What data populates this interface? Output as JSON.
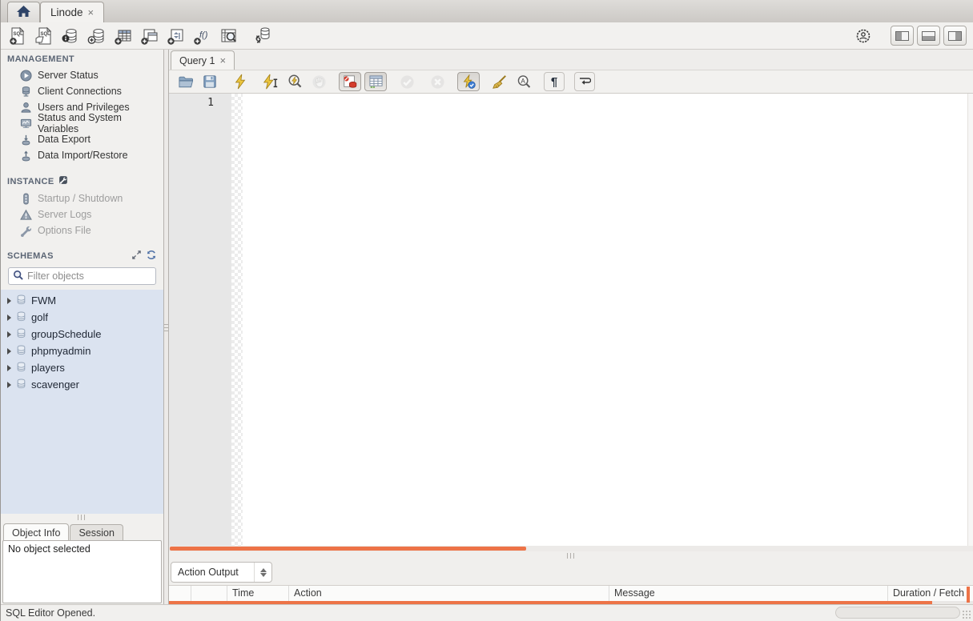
{
  "window": {
    "connection_tabs": [
      {
        "label": "",
        "icon": "home-icon"
      },
      {
        "label": "Linode",
        "close": "×",
        "active": true
      }
    ],
    "status_bar_message": "SQL Editor Opened."
  },
  "main_toolbar": {
    "left_icons": [
      "new-sql-tab-icon",
      "open-sql-script-icon",
      "schema-inspector-icon",
      "create-schema-icon",
      "create-table-icon",
      "create-view-icon",
      "create-procedure-icon",
      "create-function-icon",
      "search-table-data-icon",
      "reconnect-dbms-icon"
    ],
    "right_icons": [
      "account-gear-icon",
      "toggle-left-sidebar-icon",
      "toggle-output-area-icon",
      "toggle-right-sidebar-icon"
    ]
  },
  "sidebar": {
    "management": {
      "title": "MANAGEMENT",
      "items": [
        {
          "label": "Server Status",
          "icon": "server-status-icon"
        },
        {
          "label": "Client Connections",
          "icon": "client-connections-icon"
        },
        {
          "label": "Users and Privileges",
          "icon": "users-icon"
        },
        {
          "label": "Status and System Variables",
          "icon": "system-variables-icon"
        },
        {
          "label": "Data Export",
          "icon": "data-export-icon"
        },
        {
          "label": "Data Import/Restore",
          "icon": "data-import-icon"
        }
      ]
    },
    "instance": {
      "title": "INSTANCE",
      "title_icon": "wrench-icon",
      "items": [
        {
          "label": "Startup / Shutdown",
          "icon": "startup-shutdown-icon",
          "disabled": true
        },
        {
          "label": "Server Logs",
          "icon": "server-logs-icon",
          "disabled": true
        },
        {
          "label": "Options File",
          "icon": "options-file-icon",
          "disabled": true
        }
      ]
    },
    "schemas": {
      "title": "SCHEMAS",
      "header_icons": [
        "expand-icon",
        "refresh-icon"
      ],
      "filter_placeholder": "Filter objects",
      "items": [
        "FWM",
        "golf",
        "groupSchedule",
        "phpmyadmin",
        "players",
        "scavenger"
      ]
    },
    "info_tabs": [
      {
        "label": "Object Info",
        "active": true
      },
      {
        "label": "Session",
        "active": false
      }
    ],
    "object_info_text": "No object selected"
  },
  "editor": {
    "tab_label": "Query 1",
    "tab_close": "×",
    "line_numbers": [
      "1"
    ],
    "toolbar_icons": [
      "open-file-icon",
      "save-icon",
      "execute-icon",
      "execute-current-icon",
      "explain-icon",
      "stop-icon",
      "toggle-stop-on-error-icon",
      "limit-rows-icon",
      "commit-icon",
      "rollback-icon",
      "toggle-autocommit-icon",
      "clear-icon",
      "find-icon",
      "show-invisibles-icon",
      "wrap-text-icon"
    ]
  },
  "output": {
    "selector_label": "Action Output",
    "columns": [
      "",
      "",
      "Time",
      "Action",
      "Message",
      "Duration / Fetch"
    ]
  },
  "colors": {
    "accent_orange": "#ed7347",
    "schema_list_blue": "#dbe3f0",
    "section_header": "#5b6574"
  }
}
